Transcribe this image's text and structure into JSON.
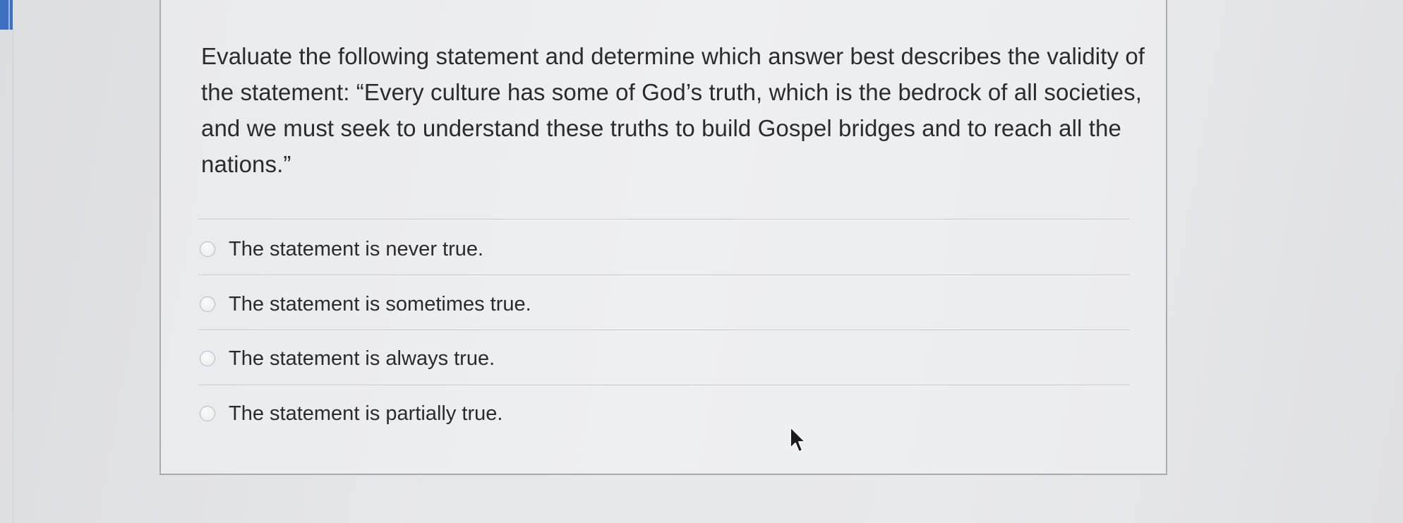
{
  "question": {
    "text": "Evaluate the following statement and determine which answer best describes the validity of the statement: “Every culture has some of God’s truth, which is the bedrock of all societies, and we must seek to understand these truths to build Gospel bridges and to reach all the nations.”"
  },
  "options": [
    {
      "label": "The statement is never true.",
      "selected": false
    },
    {
      "label": "The statement is sometimes true.",
      "selected": false
    },
    {
      "label": "The statement is always true.",
      "selected": false
    },
    {
      "label": "The statement is partially true.",
      "selected": false
    }
  ],
  "icons": {
    "radio": "radio-button-icon",
    "cursor": "mouse-pointer-icon"
  },
  "colors": {
    "accent": "#3c6fc0",
    "text": "#2b2b2e",
    "border": "#a8aaae"
  }
}
